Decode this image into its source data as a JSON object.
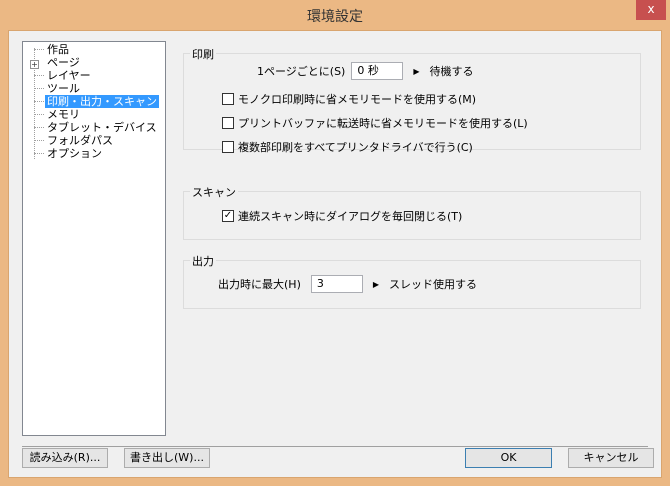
{
  "window": {
    "title": "環境設定",
    "close_label": "x"
  },
  "tree": {
    "items": [
      {
        "label": "作品"
      },
      {
        "label": "ページ",
        "expandable": true
      },
      {
        "label": "レイヤー"
      },
      {
        "label": "ツール"
      },
      {
        "label": "印刷・出力・スキャン",
        "selected": true
      },
      {
        "label": "メモリ"
      },
      {
        "label": "タブレット・デバイス"
      },
      {
        "label": "フォルダパス"
      },
      {
        "label": "オプション"
      }
    ],
    "expand_symbol": "+"
  },
  "print": {
    "title": "印刷",
    "wait_label": "1ページごとに(S)",
    "wait_value": "0 秒",
    "wait_suffix": "待機する",
    "options": [
      {
        "label": "モノクロ印刷時に省メモリモードを使用する(M)",
        "checked": false
      },
      {
        "label": "プリントバッファに転送時に省メモリモードを使用する(L)",
        "checked": false
      },
      {
        "label": "複数部印刷をすべてプリンタドライバで行う(C)",
        "checked": false
      }
    ]
  },
  "scan": {
    "title": "スキャン",
    "option": {
      "label": "連続スキャン時にダイアログを毎回閉じる(T)",
      "checked": true,
      "mark": "✓"
    }
  },
  "output": {
    "title": "出力",
    "label": "出力時に最大(H)",
    "value": "3",
    "suffix": "スレッド使用する"
  },
  "buttons": {
    "import": "読み込み(R)...",
    "export": "書き出し(W)...",
    "ok": "OK",
    "cancel": "キャンセル"
  },
  "arrow": "▶"
}
